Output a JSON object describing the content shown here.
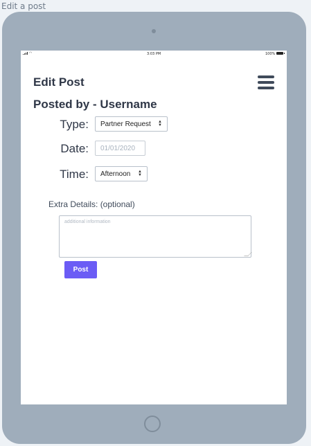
{
  "frame_label": "Edit a post",
  "status_bar": {
    "time": "3:03 PM",
    "battery": "100%"
  },
  "header": {
    "title": "Edit Post",
    "menu_icon": "hamburger-menu-icon"
  },
  "posted_by": "Posted by - Username",
  "form": {
    "type_label": "Type:",
    "type_value": "Partner Request",
    "date_label": "Date:",
    "date_placeholder": "01/01/2020",
    "time_label": "Time:",
    "time_value": "Afternoon",
    "extra_label": "Extra Details: (optional)",
    "extra_placeholder": "additional information",
    "post_label": "Post"
  },
  "colors": {
    "device": "#9fadbb",
    "accent": "#6b5cf5",
    "heading": "#2f3747"
  }
}
